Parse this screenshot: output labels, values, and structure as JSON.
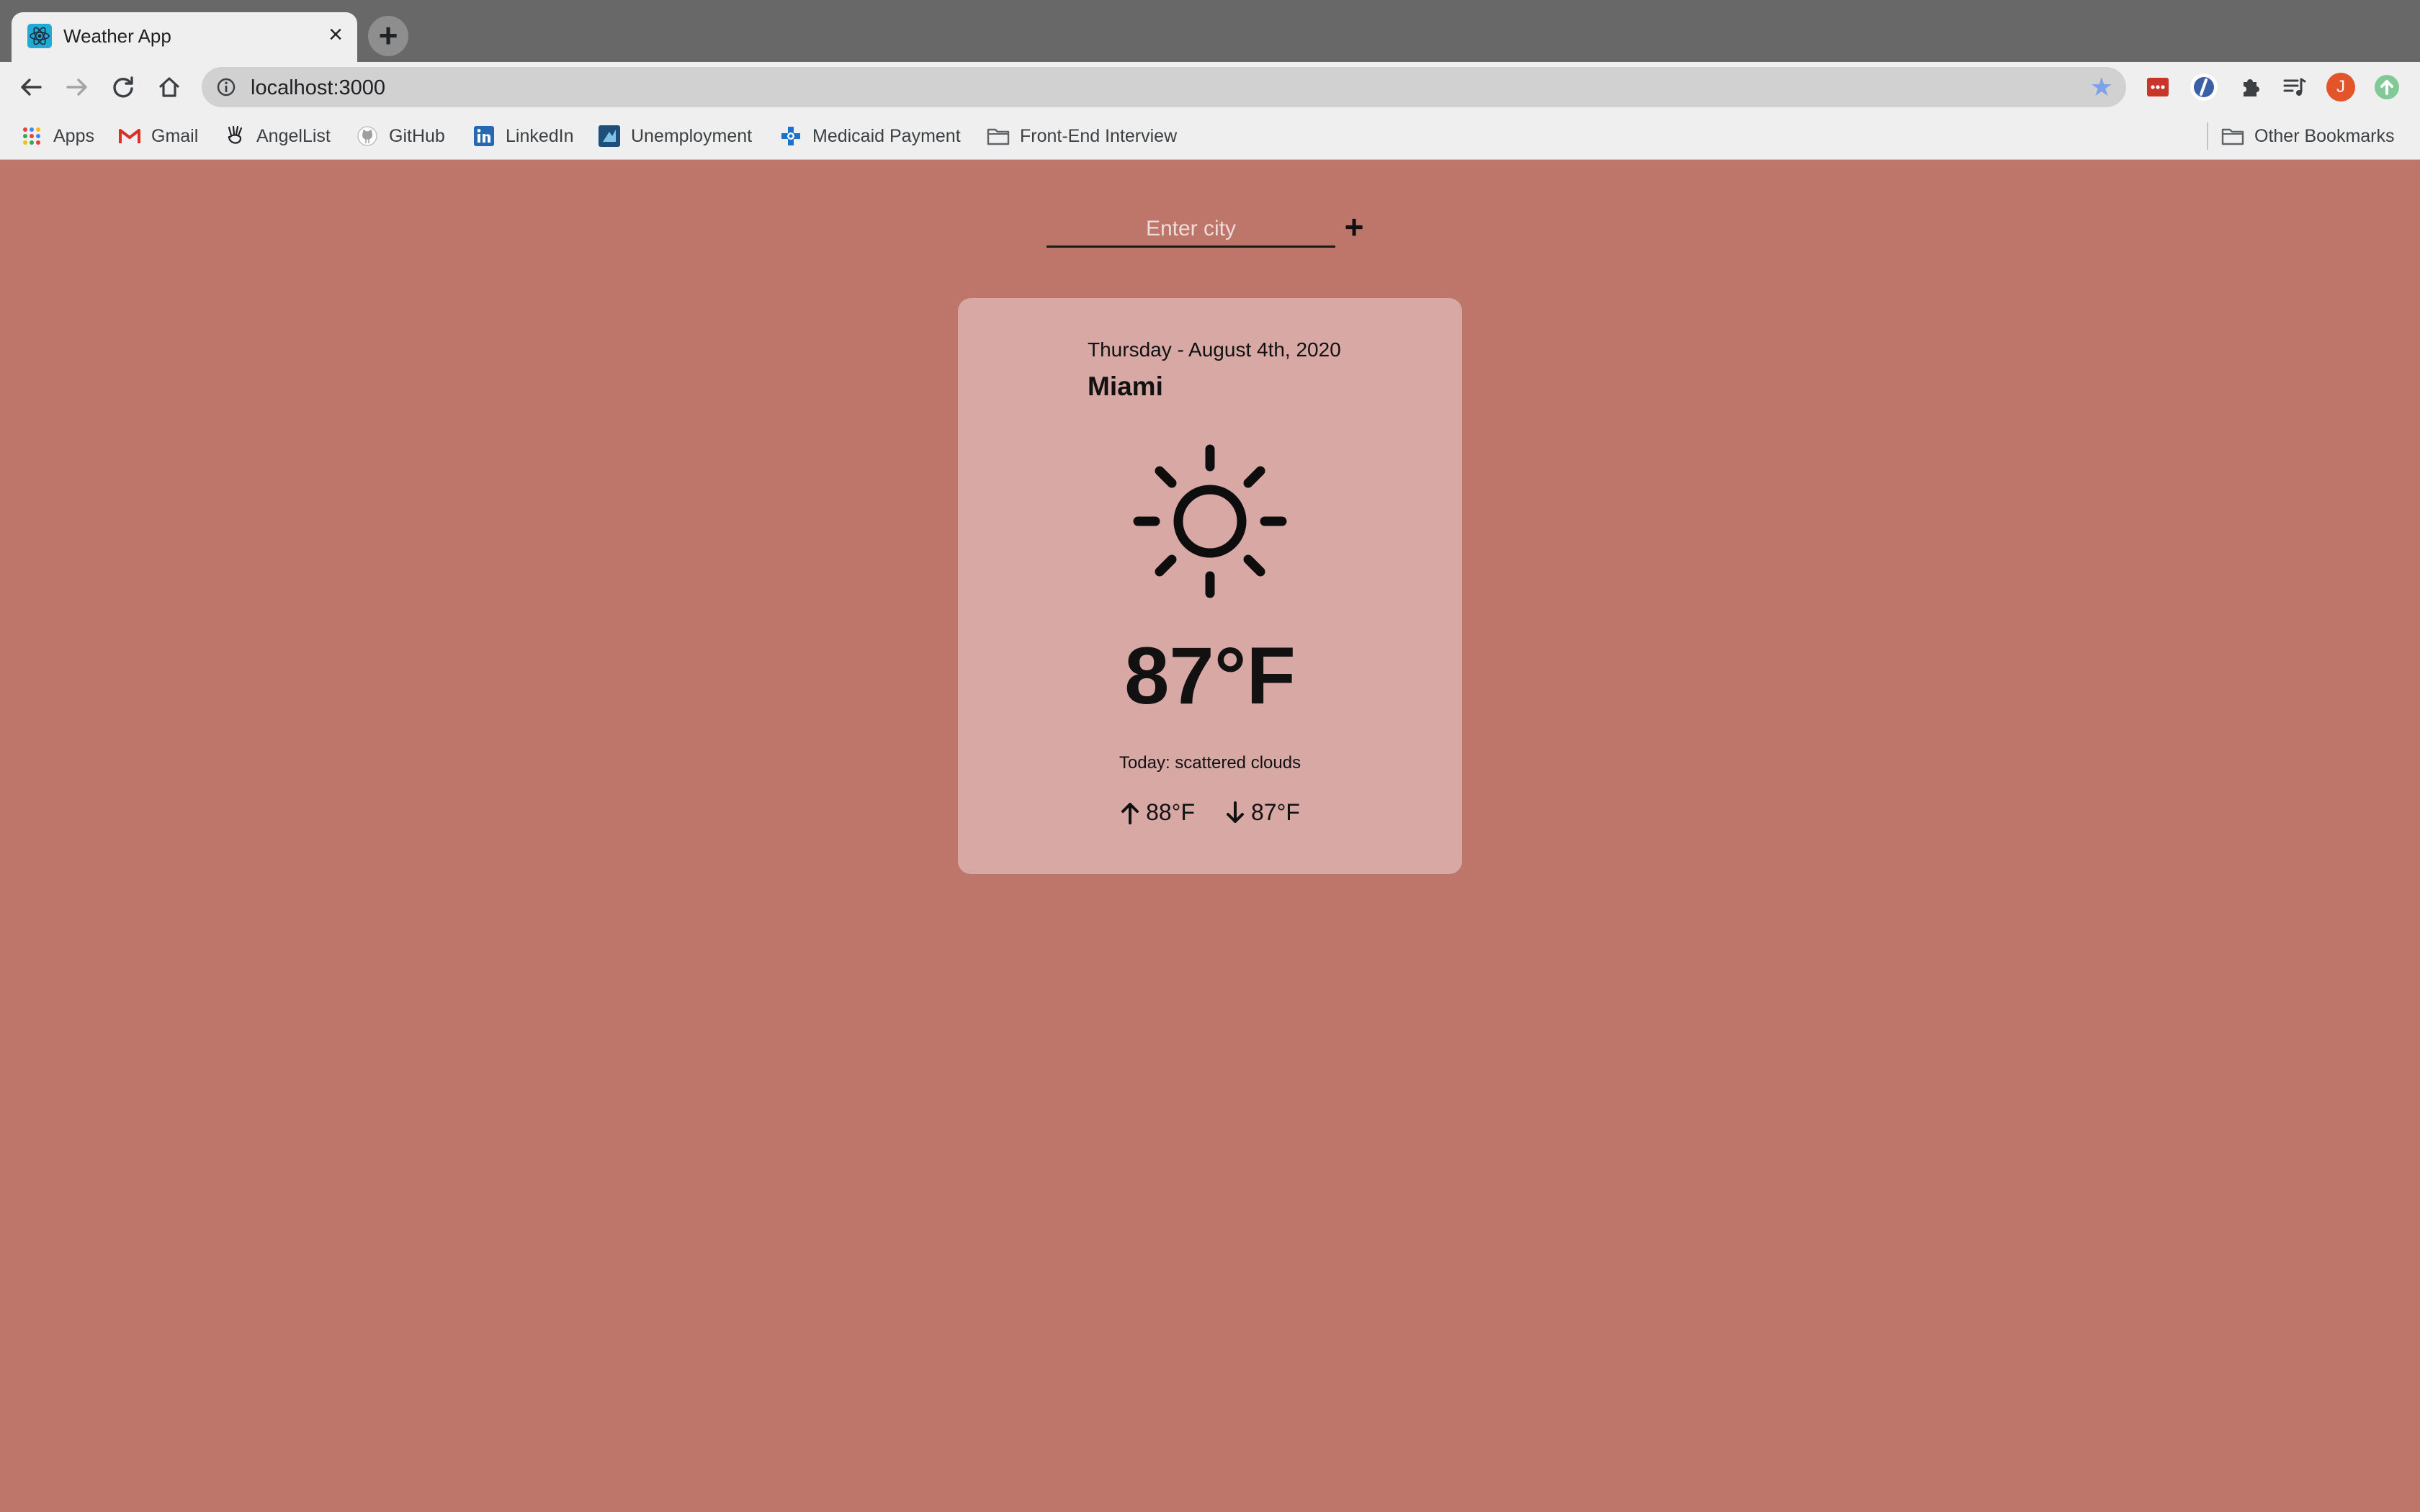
{
  "browser": {
    "tab": {
      "title": "Weather App",
      "icon": "react-icon"
    },
    "new_tab": "+",
    "url": "localhost:3000",
    "bookmarks": [
      {
        "label": "Apps",
        "icon": "apps-grid-icon"
      },
      {
        "label": "Gmail",
        "icon": "gmail-icon"
      },
      {
        "label": "AngelList",
        "icon": "angellist-icon"
      },
      {
        "label": "GitHub",
        "icon": "github-icon"
      },
      {
        "label": "LinkedIn",
        "icon": "linkedin-icon"
      },
      {
        "label": "Unemployment",
        "icon": "unemployment-icon"
      },
      {
        "label": "Medicaid Payment",
        "icon": "medicaid-icon"
      },
      {
        "label": "Front-End Interview",
        "icon": "folder-icon"
      }
    ],
    "other_bookmarks": "Other Bookmarks",
    "profile_initial": "J"
  },
  "weather": {
    "search_placeholder": "Enter city",
    "add_label": "+",
    "date": "Thursday - August 4th, 2020",
    "city": "Miami",
    "condition_icon": "sun-icon",
    "temperature": "87°F",
    "description": "Today: scattered clouds",
    "high": "88°F",
    "low": "87°F"
  },
  "colors": {
    "background": "#bf766a",
    "card": "#d8a8a5",
    "text": "#111111"
  }
}
